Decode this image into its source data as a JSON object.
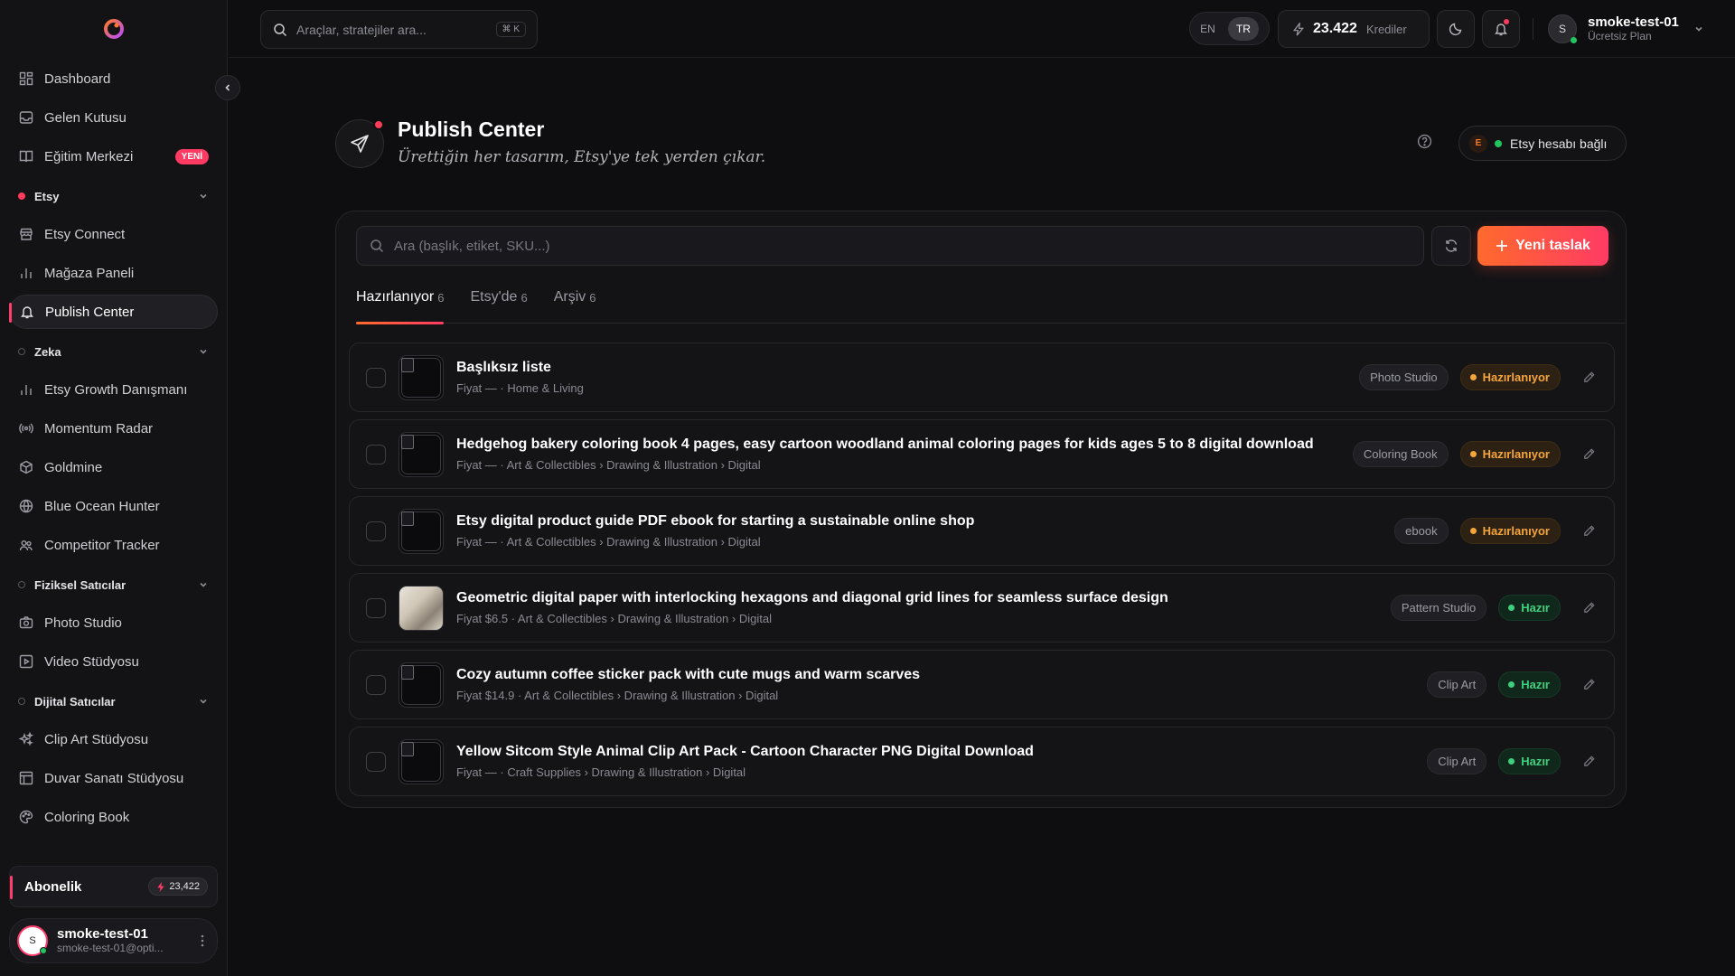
{
  "sidebar": {
    "top_items": [
      {
        "label": "Dashboard",
        "icon": "dashboard-icon"
      },
      {
        "label": "Gelen Kutusu",
        "icon": "inbox-icon"
      },
      {
        "label": "Eğitim Merkezi",
        "icon": "book-icon",
        "badge": "YENİ"
      }
    ],
    "sections": [
      {
        "label": "Etsy",
        "dot": "filled",
        "items": [
          {
            "label": "Etsy Connect",
            "icon": "store-icon"
          },
          {
            "label": "Mağaza Paneli",
            "icon": "bar-chart-icon"
          },
          {
            "label": "Publish Center",
            "icon": "bell-icon",
            "active": true
          }
        ]
      },
      {
        "label": "Zeka",
        "dot": "hollow",
        "items": [
          {
            "label": "Etsy Growth Danışmanı",
            "icon": "bar-chart-icon"
          },
          {
            "label": "Momentum Radar",
            "icon": "radar-icon"
          },
          {
            "label": "Goldmine",
            "icon": "cube-icon"
          },
          {
            "label": "Blue Ocean Hunter",
            "icon": "globe-icon"
          },
          {
            "label": "Competitor Tracker",
            "icon": "users-icon"
          }
        ]
      },
      {
        "label": "Fiziksel Satıcılar",
        "dot": "hollow",
        "items": [
          {
            "label": "Photo Studio",
            "icon": "camera-icon"
          },
          {
            "label": "Video Stüdyosu",
            "icon": "video-icon"
          }
        ]
      },
      {
        "label": "Dijital Satıcılar",
        "dot": "hollow",
        "items": [
          {
            "label": "Clip Art Stüdyosu",
            "icon": "sparkles-icon"
          },
          {
            "label": "Duvar Sanatı Stüdyosu",
            "icon": "frame-icon"
          },
          {
            "label": "Coloring Book",
            "icon": "palette-icon"
          }
        ]
      }
    ],
    "subscription": {
      "label": "Abonelik",
      "credits": "23,422"
    },
    "user": {
      "initial": "S",
      "name": "smoke-test-01",
      "email": "smoke-test-01@opti..."
    }
  },
  "topbar": {
    "search_placeholder": "Araçlar, stratejiler ara...",
    "search_shortcut": "⌘ K",
    "lang_en": "EN",
    "lang_tr": "TR",
    "credits_value": "23.422",
    "credits_label": "Krediler",
    "user_initial": "S",
    "user_name": "smoke-test-01",
    "user_plan": "Ücretsiz Plan"
  },
  "page": {
    "title": "Publish Center",
    "subtitle": "Ürettiğin her tasarım, Etsy'ye tek yerden çıkar.",
    "etsy_badge_letter": "E",
    "etsy_status": "Etsy hesabı bağlı"
  },
  "panel": {
    "search_placeholder": "Ara (başlık, etiket, SKU...)",
    "new_button": "Yeni taslak",
    "tabs": [
      {
        "label": "Hazırlanıyor",
        "count": "6",
        "active": true
      },
      {
        "label": "Etsy'de",
        "count": "6"
      },
      {
        "label": "Arşiv",
        "count": "6"
      }
    ],
    "rows": [
      {
        "title": "Başlıksız liste",
        "meta": "Fiyat — · Home & Living",
        "tag": "Photo Studio",
        "status": "Hazırlanıyor",
        "status_kind": "draft",
        "thumb": "empty"
      },
      {
        "title": "Hedgehog bakery coloring book 4 pages, easy cartoon woodland animal coloring pages for kids ages 5 to 8 digital download",
        "meta": "Fiyat — · Art & Collectibles › Drawing & Illustration › Digital",
        "tag": "Coloring Book",
        "status": "Hazırlanıyor",
        "status_kind": "draft",
        "thumb": "empty"
      },
      {
        "title": "Etsy digital product guide PDF ebook for starting a sustainable online shop",
        "meta": "Fiyat — · Art & Collectibles › Drawing & Illustration › Digital",
        "tag": "ebook",
        "status": "Hazırlanıyor",
        "status_kind": "draft",
        "thumb": "empty"
      },
      {
        "title": "Geometric digital paper with interlocking hexagons and diagonal grid lines for seamless surface design",
        "meta": "Fiyat $6.5 · Art & Collectibles › Drawing & Illustration › Digital",
        "tag": "Pattern Studio",
        "status": "Hazır",
        "status_kind": "ready",
        "thumb": "photo"
      },
      {
        "title": "Cozy autumn coffee sticker pack with cute mugs and warm scarves",
        "meta": "Fiyat $14.9 · Art & Collectibles › Drawing & Illustration › Digital",
        "tag": "Clip Art",
        "status": "Hazır",
        "status_kind": "ready",
        "thumb": "empty"
      },
      {
        "title": "Yellow Sitcom Style Animal Clip Art Pack - Cartoon Character PNG Digital Download",
        "meta": "Fiyat — · Craft Supplies › Drawing & Illustration › Digital",
        "tag": "Clip Art",
        "status": "Hazır",
        "status_kind": "ready",
        "thumb": "empty"
      }
    ]
  },
  "colors": {
    "accent": "#ff3b64",
    "accent2": "#ff6a2c",
    "draft": "#f6a53a",
    "ready": "#3fd07f"
  }
}
